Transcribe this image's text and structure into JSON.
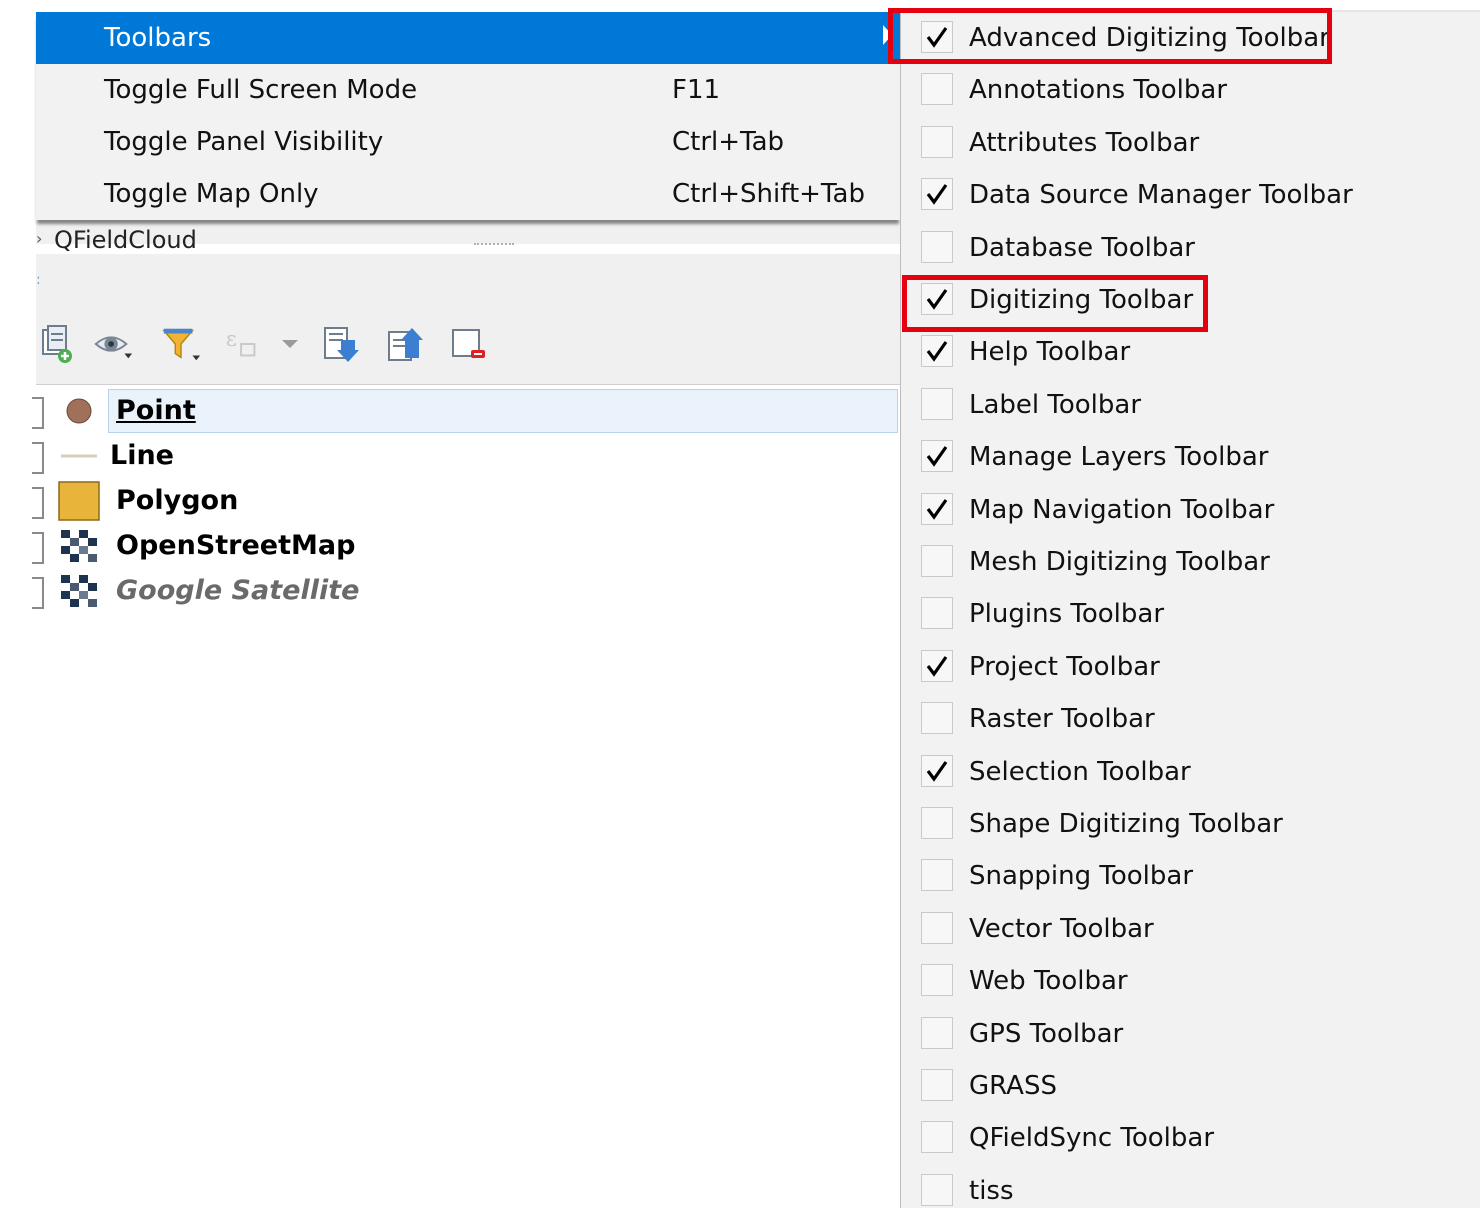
{
  "main_menu": {
    "items": [
      {
        "label": "Toolbars",
        "shortcut": "",
        "highlighted": true,
        "has_submenu": true
      },
      {
        "label": "Toggle Full Screen Mode",
        "shortcut": "F11"
      },
      {
        "label": "Toggle Panel Visibility",
        "shortcut": "Ctrl+Tab"
      },
      {
        "label": "Toggle Map Only",
        "shortcut": "Ctrl+Shift+Tab"
      }
    ]
  },
  "panel": {
    "title": "QFieldCloud"
  },
  "layer_toolbar": {
    "icons": [
      "add-group-icon",
      "manage-visibility-icon",
      "filter-legend-icon",
      "filter-expression-icon",
      "expand-all-icon",
      "collapse-all-icon",
      "remove-layer-icon"
    ]
  },
  "layers": [
    {
      "name": "Point",
      "symbol": "circle",
      "color": "#a0705a",
      "style": "bold",
      "selected": true
    },
    {
      "name": "Line",
      "symbol": "line",
      "color": "#d8cfb8",
      "style": "bold"
    },
    {
      "name": "Polygon",
      "symbol": "polygon",
      "color": "#e8b53a",
      "style": "bold"
    },
    {
      "name": "OpenStreetMap",
      "symbol": "raster",
      "style": "bold"
    },
    {
      "name": "Google Satellite",
      "symbol": "raster",
      "style": "italic"
    }
  ],
  "toolbars_submenu": {
    "items": [
      {
        "label": "Advanced Digitizing Toolbar",
        "checked": true,
        "highlighted_box": true
      },
      {
        "label": "Annotations Toolbar",
        "checked": false
      },
      {
        "label": "Attributes Toolbar",
        "checked": false
      },
      {
        "label": "Data Source Manager Toolbar",
        "checked": true
      },
      {
        "label": "Database Toolbar",
        "checked": false
      },
      {
        "label": "Digitizing Toolbar",
        "checked": true,
        "highlighted_box": true
      },
      {
        "label": "Help Toolbar",
        "checked": true
      },
      {
        "label": "Label Toolbar",
        "checked": false
      },
      {
        "label": "Manage Layers Toolbar",
        "checked": true
      },
      {
        "label": "Map Navigation Toolbar",
        "checked": true
      },
      {
        "label": "Mesh Digitizing Toolbar",
        "checked": false
      },
      {
        "label": "Plugins Toolbar",
        "checked": false
      },
      {
        "label": "Project Toolbar",
        "checked": true
      },
      {
        "label": "Raster Toolbar",
        "checked": false
      },
      {
        "label": "Selection Toolbar",
        "checked": true
      },
      {
        "label": "Shape Digitizing Toolbar",
        "checked": false
      },
      {
        "label": "Snapping Toolbar",
        "checked": false
      },
      {
        "label": "Vector Toolbar",
        "checked": false
      },
      {
        "label": "Web Toolbar",
        "checked": false
      },
      {
        "label": "GPS Toolbar",
        "checked": false
      },
      {
        "label": "GRASS",
        "checked": false
      },
      {
        "label": "QFieldSync Toolbar",
        "checked": false
      },
      {
        "label": "tiss",
        "checked": false
      }
    ]
  },
  "colors": {
    "menu_highlight": "#0078d7",
    "annotation_red": "#e4000f"
  }
}
